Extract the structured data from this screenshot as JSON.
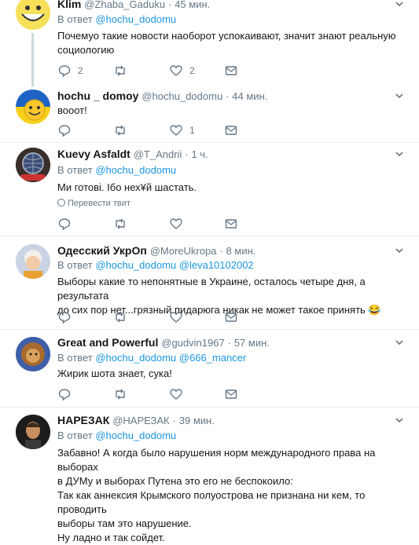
{
  "tweets": [
    {
      "name": "Klim",
      "handle": "@Zhaba_Gaduku",
      "time": "45 мин.",
      "reply_prefix": "В ответ",
      "reply_to": "@hochu_dodomu",
      "reply_to2": "",
      "text": [
        "Почемуо такие новости наоборот успокаивают, значит знают реальную",
        "социологию"
      ],
      "replies": "2",
      "retweets": "",
      "likes": "2",
      "translate": "",
      "avatar": "troll-face"
    },
    {
      "name": "hochu _ domoy",
      "handle": "@hochu_dodomu",
      "time": "44 мин.",
      "reply_prefix": "",
      "reply_to": "",
      "reply_to2": "",
      "text": [
        "вооот!"
      ],
      "replies": "",
      "retweets": "",
      "likes": "1",
      "translate": "",
      "avatar": "smiley-flag"
    },
    {
      "name": "Kuevy Asfaldt",
      "handle": "@T_Andrii",
      "time": "1 ч.",
      "reply_prefix": "В ответ",
      "reply_to": "@hochu_dodomu",
      "reply_to2": "",
      "text": [
        "Ми готові. Ібо нех¥й шастать."
      ],
      "replies": "",
      "retweets": "",
      "likes": "",
      "translate": "Перевести твит",
      "avatar": "globe"
    },
    {
      "name": "Одесский УкрОп",
      "handle": "@MoreUkropa",
      "time": "8 мин.",
      "reply_prefix": "В ответ",
      "reply_to": "@hochu_dodomu",
      "reply_to2": "@leva10102002",
      "text": [
        "Выборы какие то непонятные в Украине, осталось четыре дня, а результата",
        "до сих пор нет...грязный пидарюга никак не может такое принять 😂"
      ],
      "replies": "",
      "retweets": "",
      "likes": "",
      "translate": "",
      "avatar": "child"
    },
    {
      "name": "Great and Powerful",
      "handle": "@gudvin1967",
      "time": "57 мин.",
      "reply_prefix": "В ответ",
      "reply_to": "@hochu_dodomu",
      "reply_to2": "@666_mancer",
      "text": [
        "Жирик шота знает, сука!"
      ],
      "replies": "",
      "retweets": "",
      "likes": "",
      "translate": "",
      "avatar": "lion"
    },
    {
      "name": "НАРЕЗАК",
      "handle": "@НАРЕЗАК",
      "time": "39 мин.",
      "reply_prefix": "В ответ",
      "reply_to": "@hochu_dodomu",
      "reply_to2": "",
      "text": [
        "Забавно! А когда было нарушения норм международного права на выборах",
        "в ДУМу и выборах Путена это его не беспокоило:",
        "Так как аннексия Крымского полуострова не признана ни кем, то проводить",
        "выборы там это нарушение.",
        "Ну ладно и так сойдет."
      ],
      "replies": "",
      "retweets": "",
      "likes": "",
      "translate": "",
      "avatar": "man"
    }
  ],
  "colors": {
    "accent": "#1b95e0",
    "muted": "#657786",
    "border": "#e6ecf0"
  },
  "icons": [
    "reply-icon",
    "retweet-icon",
    "like-icon",
    "direct-message-icon",
    "chevron-down-icon",
    "globe-icon"
  ]
}
